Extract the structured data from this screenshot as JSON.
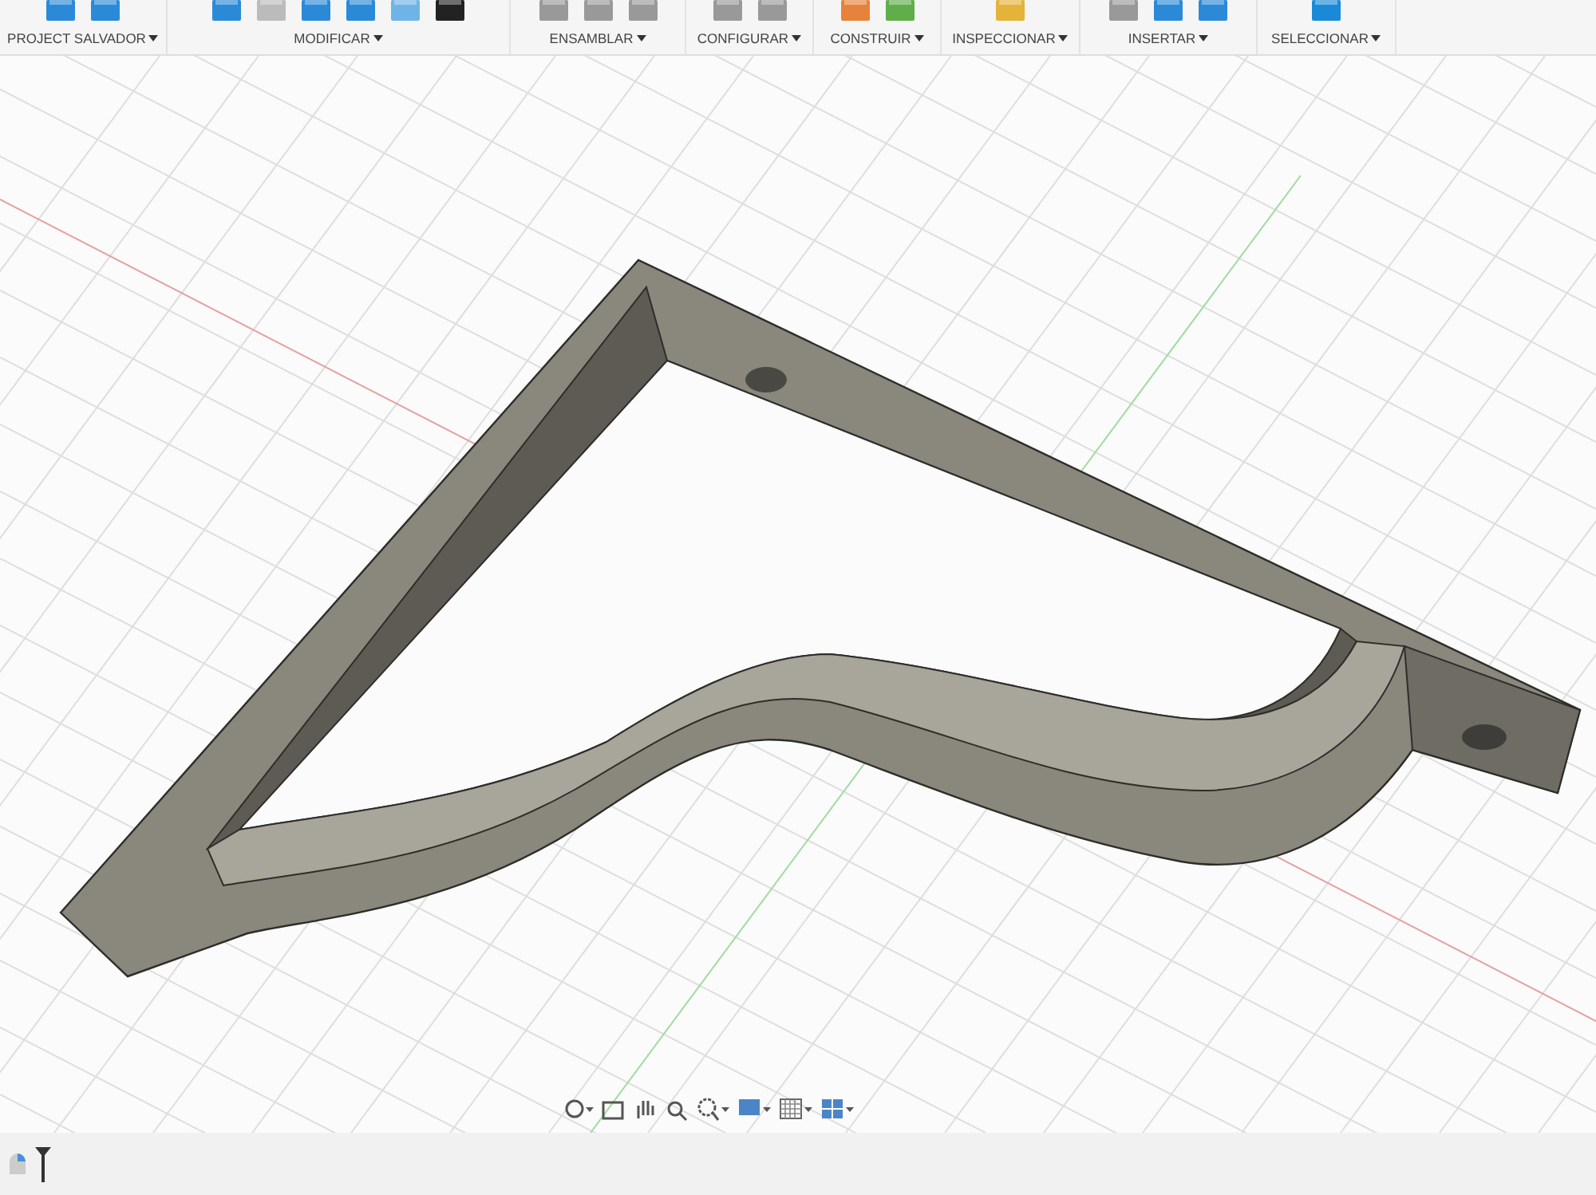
{
  "toolbar": {
    "groups": [
      {
        "label": "PROJECT SALVADOR"
      },
      {
        "label": "MODIFICAR"
      },
      {
        "label": "ENSAMBLAR"
      },
      {
        "label": "CONFIGURAR"
      },
      {
        "label": "CONSTRUIR"
      },
      {
        "label": "INSPECCIONAR"
      },
      {
        "label": "INSERTAR"
      },
      {
        "label": "SELECCIONAR"
      }
    ]
  }
}
